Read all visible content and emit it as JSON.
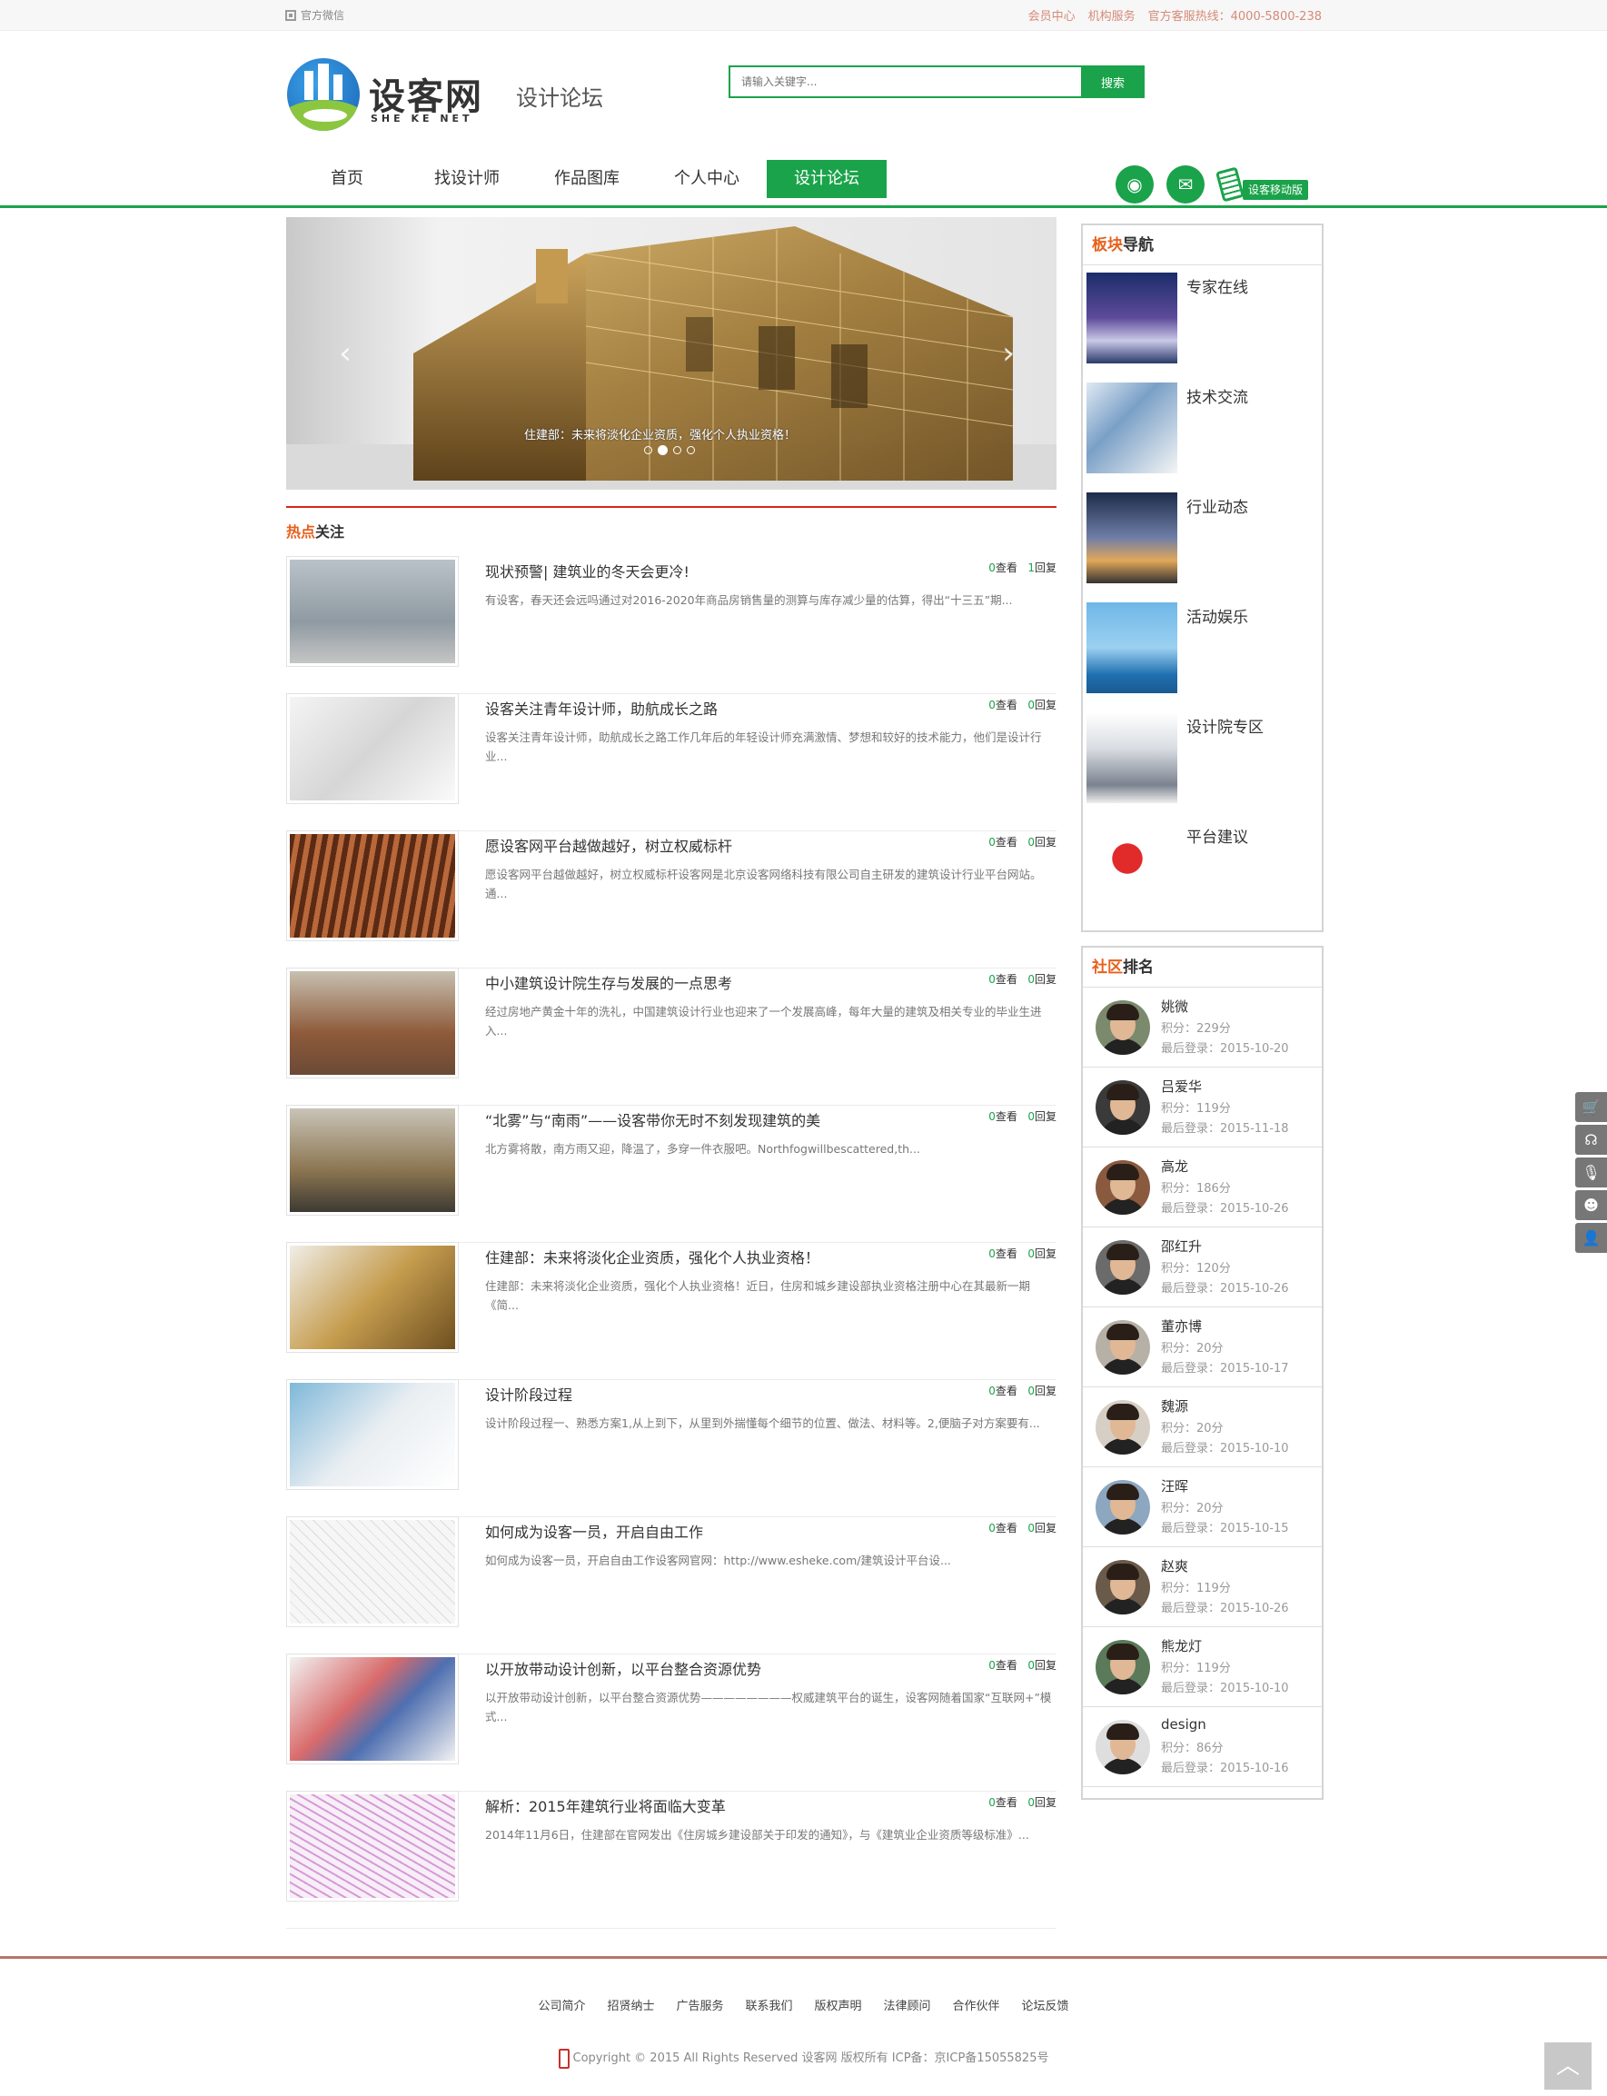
{
  "topbar": {
    "wechat": "官方微信",
    "member_center": "会员中心",
    "org_service": "机构服务",
    "hotline": "官方客服热线：4000-5800-238"
  },
  "header": {
    "logo_cn": "设客网",
    "logo_en": "SHE KE NET",
    "forum_title": "设计论坛",
    "search_placeholder": "请输入关键字...",
    "search_button": "搜索"
  },
  "nav": [
    "首页",
    "找设计师",
    "作品图库",
    "个人中心",
    "设计论坛"
  ],
  "nav_active_index": 4,
  "social": {
    "weibo_icon": "weibo-icon",
    "wechat_icon": "wechat-icon",
    "mobile_label": "设客移动版"
  },
  "slider": {
    "caption": "住建部：未来将淡化企业资质，强化个人执业资格！",
    "dots_total": 4,
    "active_dot": 1,
    "prev": "‹",
    "next": "›"
  },
  "hot": {
    "title_highlight": "热点",
    "title_rest": "关注",
    "posts": [
      {
        "title": "现状预警| 建筑业的冬天会更冷!",
        "views": "0",
        "replies": "1",
        "summary": "有设客，春天还会远吗通过对2016-2020年商品房销售量的测算与库存减少量的估算，得出“十三五”期..."
      },
      {
        "title": "设客关注青年设计师，助航成长之路",
        "views": "0",
        "replies": "0",
        "summary": "设客关注青年设计师，助航成长之路工作几年后的年轻设计师充满激情、梦想和较好的技术能力，他们是设计行业..."
      },
      {
        "title": "愿设客网平台越做越好，树立权威标杆",
        "views": "0",
        "replies": "0",
        "summary": "愿设客网平台越做越好，树立权威标杆设客网是北京设客网络科技有限公司自主研发的建筑设计行业平台网站。通..."
      },
      {
        "title": "中小建筑设计院生存与发展的一点思考",
        "views": "0",
        "replies": "0",
        "summary": "经过房地产黄金十年的洗礼，中国建筑设计行业也迎来了一个发展高峰，每年大量的建筑及相关专业的毕业生进入..."
      },
      {
        "title": "“北雾”与“南雨”——设客带你无时不刻发现建筑的美",
        "views": "0",
        "replies": "0",
        "summary": "北方雾将散，南方雨又迎，降温了，多穿一件衣服吧。Northfogwillbescattered,th..."
      },
      {
        "title": "住建部：未来将淡化企业资质，强化个人执业资格！",
        "views": "0",
        "replies": "0",
        "summary": "住建部：未来将淡化企业资质，强化个人执业资格！近日，住房和城乡建设部执业资格注册中心在其最新一期《简..."
      },
      {
        "title": "设计阶段过程",
        "views": "0",
        "replies": "0",
        "summary": "设计阶段过程一、熟悉方案1,从上到下，从里到外揣懂每个细节的位置、做法、材料等。2,便脑子对方案要有..."
      },
      {
        "title": "如何成为设客一员，开启自由工作",
        "views": "0",
        "replies": "0",
        "summary": "如何成为设客一员，开启自由工作设客网官网：http://www.esheke.com/建筑设计平台设..."
      },
      {
        "title": "以开放带动设计创新，以平台整合资源优势",
        "views": "0",
        "replies": "0",
        "summary": "以开放带动设计创新，以平台整合资源优势————————权威建筑平台的诞生，设客网随着国家“互联网+”模式..."
      },
      {
        "title": "解析：2015年建筑行业将面临大变革",
        "views": "0",
        "replies": "0",
        "summary": "2014年11月6日，住建部在官网发出《住房城乡建设部关于印发的通知》，与《建筑业企业资质等级标准》..."
      }
    ],
    "views_label": "查看",
    "replies_label": "回复"
  },
  "sidebar": {
    "boards": {
      "title_highlight": "板块",
      "title_rest": "导航",
      "items": [
        "专家在线",
        "技术交流",
        "行业动态",
        "活动娱乐",
        "设计院专区",
        "平台建议"
      ]
    },
    "ranking": {
      "title_highlight": "社区",
      "title_rest": "排名",
      "score_label": "积分：",
      "last_label": "最后登录：",
      "items": [
        {
          "name": "姚微",
          "score": "229分",
          "last": "2015-10-20"
        },
        {
          "name": "吕爱华",
          "score": "119分",
          "last": "2015-11-18"
        },
        {
          "name": "高龙",
          "score": "186分",
          "last": "2015-10-26"
        },
        {
          "name": "邵红升",
          "score": "120分",
          "last": "2015-10-26"
        },
        {
          "name": "董亦博",
          "score": "20分",
          "last": "2015-10-17"
        },
        {
          "name": "魏源",
          "score": "20分",
          "last": "2015-10-10"
        },
        {
          "name": "汪晖",
          "score": "20分",
          "last": "2015-10-15"
        },
        {
          "name": "赵爽",
          "score": "119分",
          "last": "2015-10-26"
        },
        {
          "name": "熊龙灯",
          "score": "119分",
          "last": "2015-10-10"
        },
        {
          "name": "design",
          "score": "86分",
          "last": "2015-10-16"
        }
      ]
    }
  },
  "tools": [
    "cart-icon",
    "headset-icon",
    "mic-icon",
    "qq-icon",
    "user-icon"
  ],
  "footer": {
    "links": [
      "公司简介",
      "招贤纳士",
      "广告服务",
      "联系我们",
      "版权声明",
      "法律顾问",
      "合作伙伴",
      "论坛反馈"
    ],
    "copyright": "Copyright © 2015 All Rights Reserved 设客网 版权所有 ICP备：京ICP备15055825号",
    "back_to_top": "︿"
  },
  "colors": {
    "brand_green": "#1aa34a",
    "accent_orange": "#e8601c",
    "accent_red": "#d9241c"
  }
}
